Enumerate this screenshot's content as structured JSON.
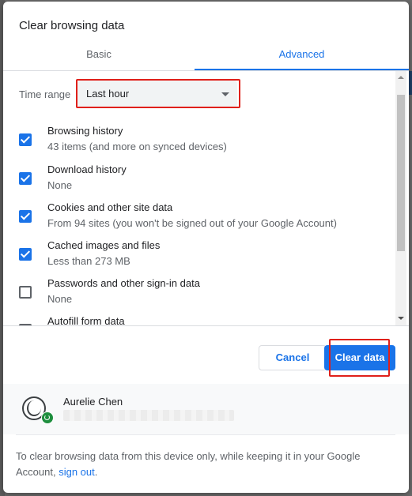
{
  "dialog": {
    "title": "Clear browsing data"
  },
  "tabs": [
    {
      "label": "Basic",
      "selected": false
    },
    {
      "label": "Advanced",
      "selected": true
    }
  ],
  "time_range": {
    "label": "Time range",
    "value": "Last hour"
  },
  "items": [
    {
      "title": "Browsing history",
      "subtitle": "43 items (and more on synced devices)",
      "checked": true
    },
    {
      "title": "Download history",
      "subtitle": "None",
      "checked": true
    },
    {
      "title": "Cookies and other site data",
      "subtitle": "From 94 sites (you won't be signed out of your Google Account)",
      "checked": true
    },
    {
      "title": "Cached images and files",
      "subtitle": "Less than 273 MB",
      "checked": true
    },
    {
      "title": "Passwords and other sign-in data",
      "subtitle": "None",
      "checked": false
    },
    {
      "title": "Autofill form data",
      "subtitle": "",
      "checked": false
    }
  ],
  "buttons": {
    "cancel": "Cancel",
    "clear": "Clear data"
  },
  "account": {
    "name": "Aurelie Chen"
  },
  "footer": {
    "text": "To clear browsing data from this device only, while keeping it in your Google Account,",
    "link": "sign out",
    "end": "."
  },
  "colors": {
    "accent": "#1a73e8",
    "highlight": "#e0201a",
    "sync_badge": "#1e8e3e"
  }
}
